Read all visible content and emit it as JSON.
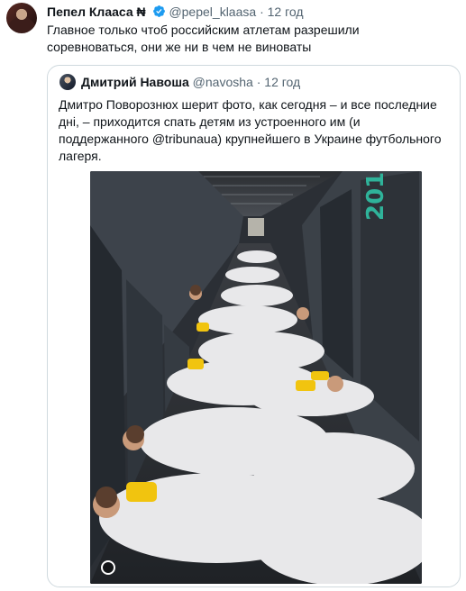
{
  "tweet": {
    "author_name": "Пепел Клааса",
    "name_emoji": "₦",
    "handle": "@pepel_klaasa",
    "separator": "·",
    "time": "12 год",
    "text": "Главное только чтоб российским атлетам разрешили соревноваться, они же ни в чем не виноваты"
  },
  "quote": {
    "author_name": "Дмитрий Навоша",
    "handle": "@navosha",
    "separator": "·",
    "time": "12 год",
    "text": "Дмитро Поворознюх шерит фото, как сегодня – и все последние дні, – приходится спать детям из устроенного им (и поддержанного @tribunaua) крупнейшего в Украине футбольного лагеря."
  },
  "colors": {
    "verified": "#1d9bf0",
    "secondary_text": "#536471",
    "border": "#cfd9de"
  },
  "icons": [
    "verified-badge-icon",
    "instagram-icon"
  ]
}
